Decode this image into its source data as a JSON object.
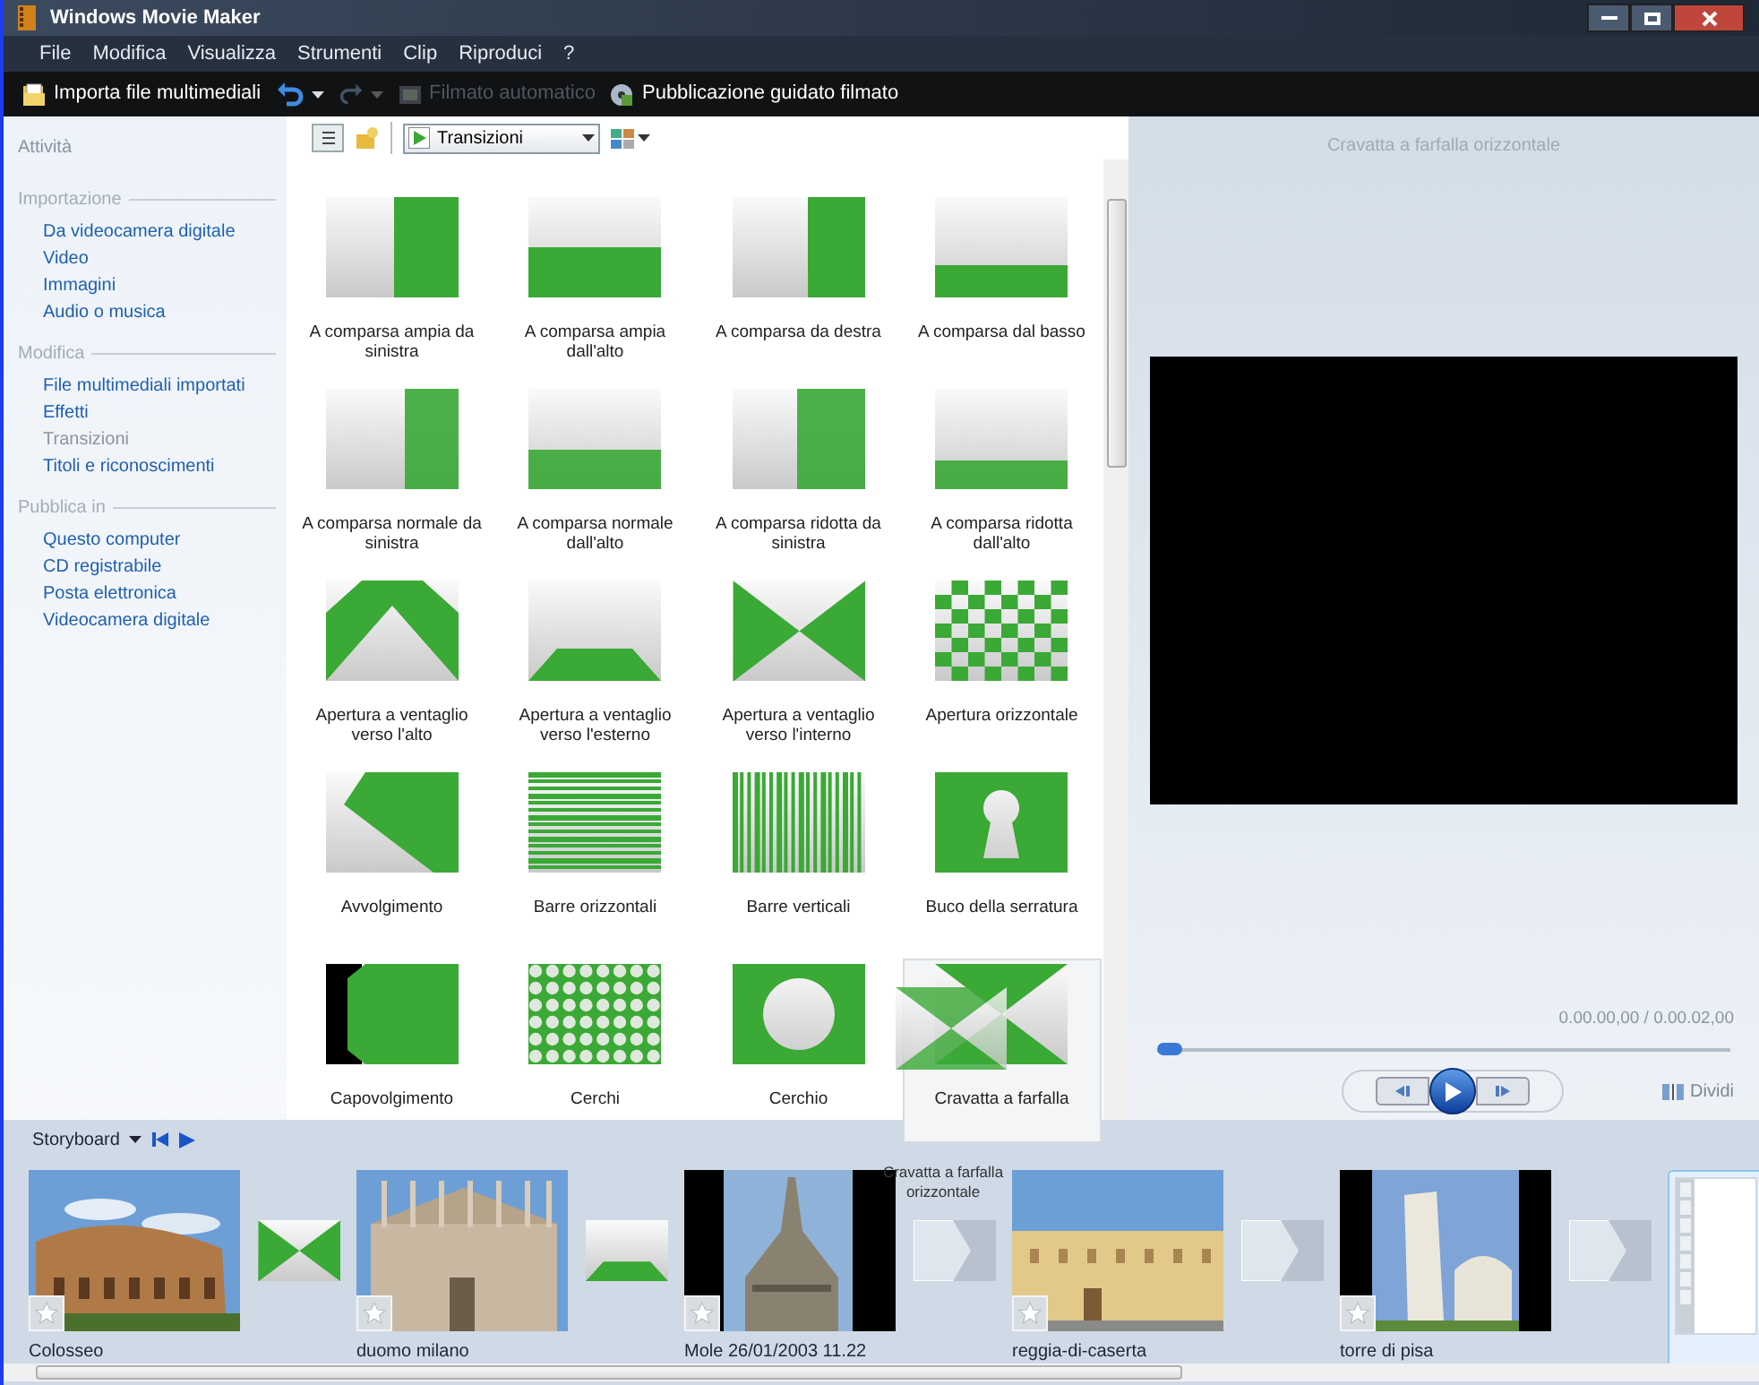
{
  "window": {
    "title": "Windows Movie Maker"
  },
  "menu": [
    "File",
    "Modifica",
    "Visualizza",
    "Strumenti",
    "Clip",
    "Riproduci",
    "?"
  ],
  "toolbar": [
    {
      "kind": "import",
      "label": "Importa file multimediali",
      "disabled": false
    },
    {
      "kind": "undo",
      "disabled": false
    },
    {
      "kind": "redo",
      "disabled": true
    },
    {
      "kind": "auto",
      "label": "Filmato automatico",
      "disabled": true
    },
    {
      "kind": "publish",
      "label": "Pubblicazione guidato filmato",
      "disabled": false
    }
  ],
  "sidebar": {
    "title": "Attività",
    "sections": [
      {
        "title": "Importazione",
        "items": [
          {
            "label": "Da videocamera digitale",
            "disabled": false
          },
          {
            "label": "Video",
            "disabled": false
          },
          {
            "label": "Immagini",
            "disabled": false
          },
          {
            "label": "Audio o musica",
            "disabled": false
          }
        ]
      },
      {
        "title": "Modifica",
        "items": [
          {
            "label": "File multimediali importati",
            "disabled": false
          },
          {
            "label": "Effetti",
            "disabled": false
          },
          {
            "label": "Transizioni",
            "disabled": true
          },
          {
            "label": "Titoli e riconoscimenti",
            "disabled": false
          }
        ]
      },
      {
        "title": "Pubblica in",
        "items": [
          {
            "label": "Questo computer",
            "disabled": false
          },
          {
            "label": "CD registrabile",
            "disabled": false
          },
          {
            "label": "Posta elettronica",
            "disabled": false
          },
          {
            "label": "Videocamera digitale",
            "disabled": false
          }
        ]
      }
    ]
  },
  "collection": {
    "dropdown": "Transizioni"
  },
  "transitions": [
    {
      "kind": "wipe-left",
      "label": "A comparsa ampia da sinistra",
      "selected": false
    },
    {
      "kind": "wipe-top",
      "label": "A comparsa ampia dall'alto",
      "selected": false
    },
    {
      "kind": "wipe-right",
      "label": "A comparsa da destra",
      "selected": false
    },
    {
      "kind": "wipe-bottom",
      "label": "A comparsa dal basso",
      "selected": false
    },
    {
      "kind": "soft-left",
      "label": "A comparsa normale da sinistra",
      "selected": false
    },
    {
      "kind": "soft-top",
      "label": "A comparsa normale dall'alto",
      "selected": false
    },
    {
      "kind": "soft-right",
      "label": "A comparsa ridotta da sinistra",
      "selected": false
    },
    {
      "kind": "soft-bottom",
      "label": "A comparsa ridotta dall'alto",
      "selected": false
    },
    {
      "kind": "fan-up",
      "label": "Apertura a ventaglio verso l'alto",
      "selected": false
    },
    {
      "kind": "fan-out",
      "label": "Apertura a ventaglio verso l'esterno",
      "selected": false
    },
    {
      "kind": "fan-in",
      "label": "Apertura a ventaglio verso l'interno",
      "selected": false
    },
    {
      "kind": "checker",
      "label": "Apertura orizzontale",
      "selected": false
    },
    {
      "kind": "roll",
      "label": "Avvolgimento",
      "selected": false
    },
    {
      "kind": "hbars",
      "label": "Barre orizzontali",
      "selected": false
    },
    {
      "kind": "vbars",
      "label": "Barre verticali",
      "selected": false
    },
    {
      "kind": "keyhole",
      "label": "Buco della serratura",
      "selected": false
    },
    {
      "kind": "flip",
      "label": "Capovolgimento",
      "selected": false
    },
    {
      "kind": "circles",
      "label": "Cerchi",
      "selected": false
    },
    {
      "kind": "circle",
      "label": "Cerchio",
      "selected": false
    },
    {
      "kind": "bowtie",
      "label": "Cravatta a farfalla",
      "selected": true
    }
  ],
  "preview": {
    "title": "Cravatta a farfalla orizzontale",
    "time": "0.00.00,00 / 0.00.02,00",
    "level": 0,
    "split": "Dividi"
  },
  "storyboard": {
    "view": "Storyboard",
    "items": [
      {
        "kind": "clip",
        "label": "Colosseo"
      },
      {
        "kind": "fan-in"
      },
      {
        "kind": "clip",
        "label": "duomo milano"
      },
      {
        "kind": "fan-out"
      },
      {
        "kind": "clip",
        "label": "Mole 26/01/2003 11.22"
      },
      {
        "kind": "placeholder",
        "label": "Cravatta a farfalla orizzontale"
      },
      {
        "kind": "clip",
        "label": "reggia-di-caserta"
      },
      {
        "kind": "placeholder"
      },
      {
        "kind": "clip",
        "label": "torre di pisa"
      },
      {
        "kind": "placeholder"
      },
      {
        "kind": "slot",
        "selected": true
      }
    ]
  }
}
